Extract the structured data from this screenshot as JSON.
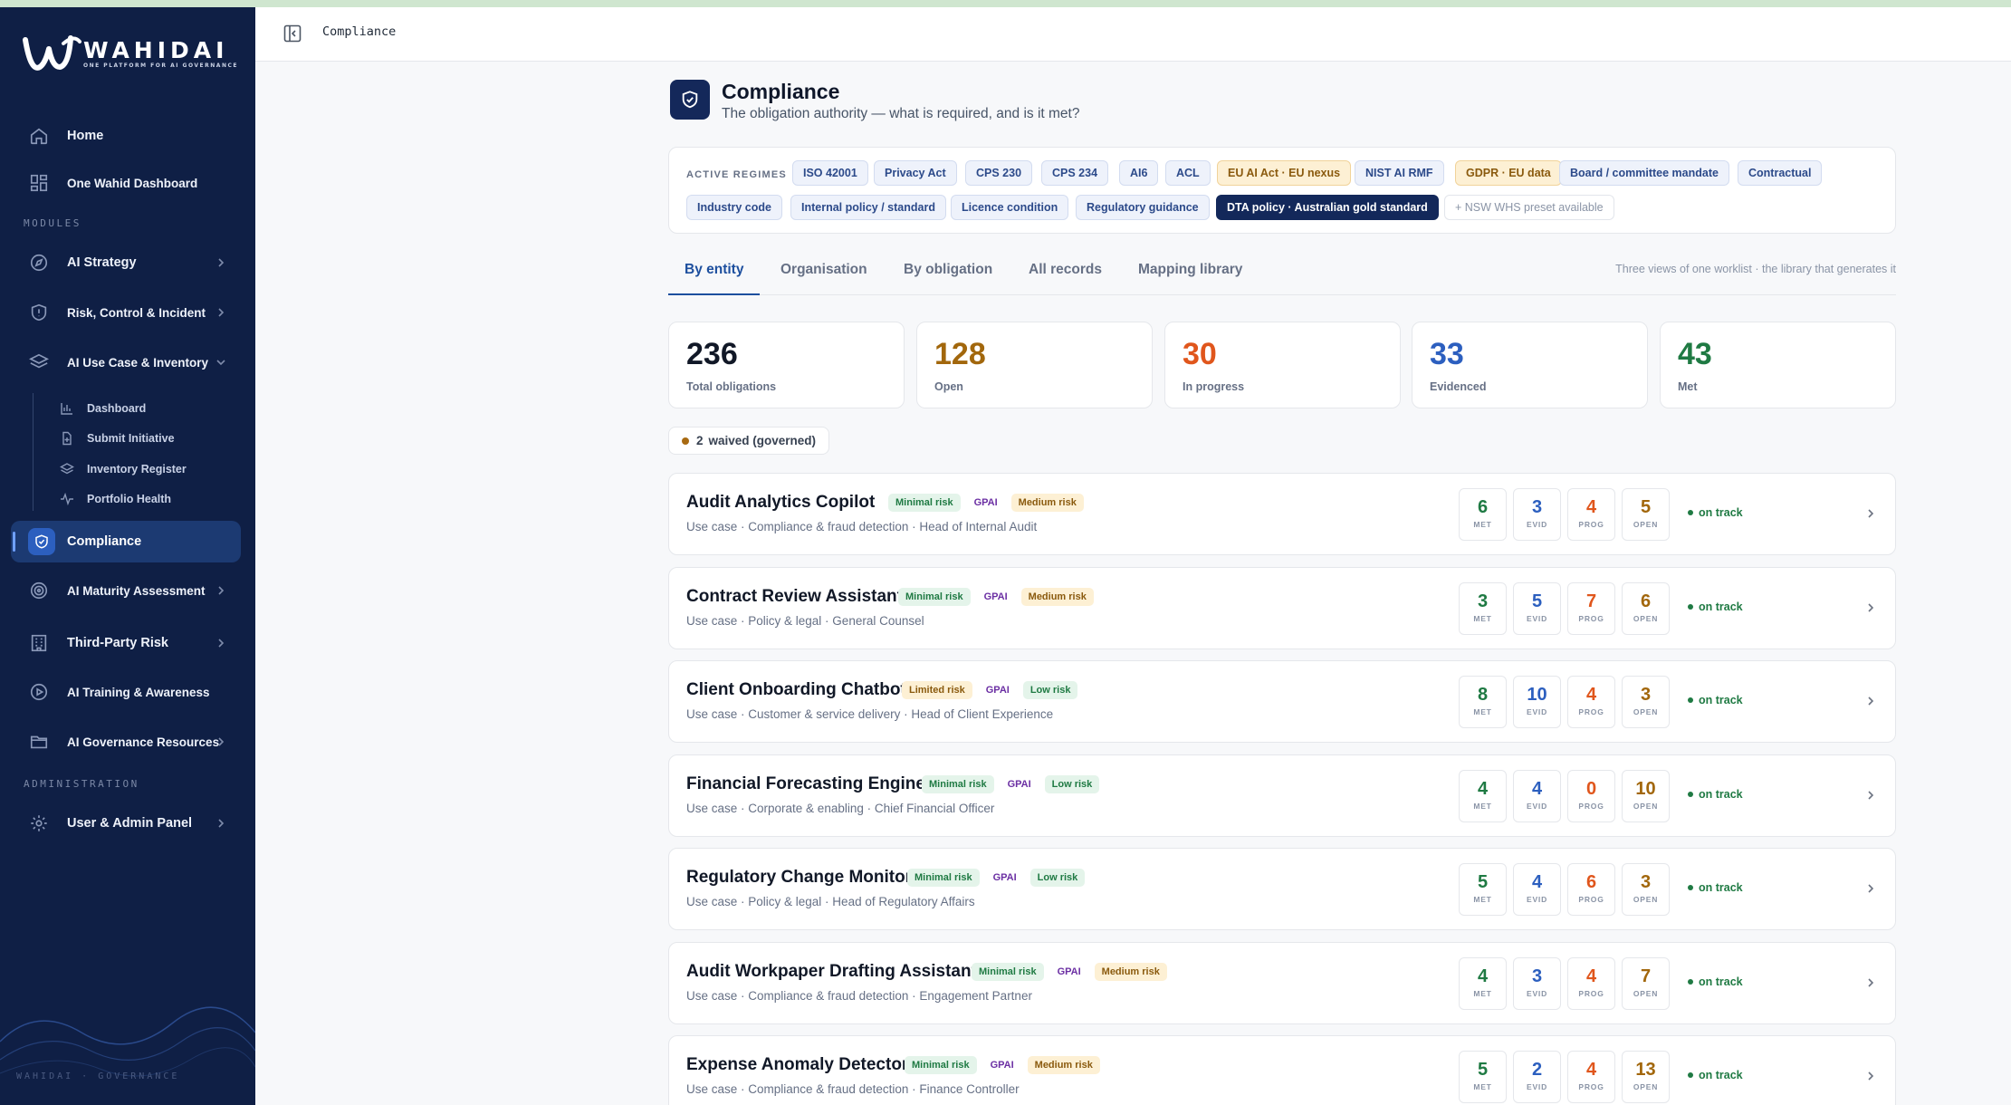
{
  "brand": {
    "name": "WAHIDAI",
    "tagline": "ONE PLATFORM FOR AI GOVERNANCE",
    "footer": "WAHIDAI · GOVERNANCE"
  },
  "sidebar": {
    "home": "Home",
    "dashboard": "One Wahid Dashboard",
    "modules_label": "MODULES",
    "modules": [
      "AI Strategy",
      "Risk, Control & Incident",
      "AI Use Case & Inventory"
    ],
    "sub_items": [
      "Dashboard",
      "Submit Initiative",
      "Inventory Register",
      "Portfolio Health"
    ],
    "compliance": "Compliance",
    "more_modules": [
      "AI Maturity Assessment",
      "Third-Party Risk",
      "AI Training & Awareness",
      "AI Governance Resources"
    ],
    "admin_label": "ADMINISTRATION",
    "admin": "User & Admin Panel"
  },
  "topbar": {
    "breadcrumb": "Compliance"
  },
  "page": {
    "title": "Compliance",
    "subtitle": "The obligation authority — what is required, and is it met?"
  },
  "regimes": {
    "label": "ACTIVE REGIMES",
    "chips": [
      "ISO 42001",
      "Privacy Act",
      "CPS 230",
      "CPS 234",
      "AI6",
      "ACL",
      "EU AI Act · EU nexus",
      "NIST AI RMF",
      "GDPR · EU data",
      "Board / committee mandate",
      "Contractual",
      "Industry code",
      "Internal policy / standard",
      "Licence condition",
      "Regulatory guidance",
      "DTA policy · Australian gold standard",
      "+ NSW WHS preset available"
    ]
  },
  "tabs": {
    "items": [
      "By entity",
      "Organisation",
      "By obligation",
      "All records",
      "Mapping library"
    ],
    "active": "By entity",
    "note": "Three views of one worklist · the library that generates it"
  },
  "stats": [
    {
      "value": "236",
      "label": "Total obligations",
      "color": "#111827"
    },
    {
      "value": "128",
      "label": "Open",
      "color": "#a2670c"
    },
    {
      "value": "30",
      "label": "In progress",
      "color": "#e0561c"
    },
    {
      "value": "33",
      "label": "Evidenced",
      "color": "#2c5fbf"
    },
    {
      "value": "43",
      "label": "Met",
      "color": "#1f7a43"
    }
  ],
  "waived": {
    "count": "2",
    "label": "waived (governed)"
  },
  "count_labels": {
    "met": "MET",
    "evid": "EVID",
    "prog": "PROG",
    "open": "OPEN"
  },
  "entities": [
    {
      "name": "Audit Analytics Copilot",
      "tags": [
        "Minimal risk",
        "GPAI",
        "Medium risk"
      ],
      "meta": "Use case · Compliance & fraud detection · Head of Internal Audit",
      "met": "6",
      "evid": "3",
      "prog": "4",
      "open": "5",
      "status": "on track"
    },
    {
      "name": "Contract Review Assistant",
      "tags": [
        "Minimal risk",
        "GPAI",
        "Medium risk"
      ],
      "meta": "Use case · Policy & legal · General Counsel",
      "met": "3",
      "evid": "5",
      "prog": "7",
      "open": "6",
      "status": "on track"
    },
    {
      "name": "Client Onboarding Chatbot",
      "tags": [
        "Limited risk",
        "GPAI",
        "Low risk"
      ],
      "meta": "Use case · Customer & service delivery · Head of Client Experience",
      "met": "8",
      "evid": "10",
      "prog": "4",
      "open": "3",
      "status": "on track"
    },
    {
      "name": "Financial Forecasting Engine",
      "tags": [
        "Minimal risk",
        "GPAI",
        "Low risk"
      ],
      "meta": "Use case · Corporate & enabling · Chief Financial Officer",
      "met": "4",
      "evid": "4",
      "prog": "0",
      "open": "10",
      "status": "on track"
    },
    {
      "name": "Regulatory Change Monitor",
      "tags": [
        "Minimal risk",
        "GPAI",
        "Low risk"
      ],
      "meta": "Use case · Policy & legal · Head of Regulatory Affairs",
      "met": "5",
      "evid": "4",
      "prog": "6",
      "open": "3",
      "status": "on track"
    },
    {
      "name": "Audit Workpaper Drafting Assistant",
      "tags": [
        "Minimal risk",
        "GPAI",
        "Medium risk"
      ],
      "meta": "Use case · Compliance & fraud detection · Engagement Partner",
      "met": "4",
      "evid": "3",
      "prog": "4",
      "open": "7",
      "status": "on track"
    },
    {
      "name": "Expense Anomaly Detector",
      "tags": [
        "Minimal risk",
        "GPAI",
        "Medium risk"
      ],
      "meta": "Use case · Compliance & fraud detection · Finance Controller",
      "met": "5",
      "evid": "2",
      "prog": "4",
      "open": "13",
      "status": "on track"
    }
  ],
  "icons": {
    "home": "home-icon",
    "dashboard": "grid-icon",
    "strategy": "compass-icon",
    "risk": "shield-alert-icon",
    "inventory": "layers-icon",
    "compliance": "shield-check-icon",
    "maturity": "target-icon",
    "third_party": "building-icon",
    "training": "play-circle-icon",
    "resources": "folder-icon",
    "admin": "gear-icon"
  }
}
